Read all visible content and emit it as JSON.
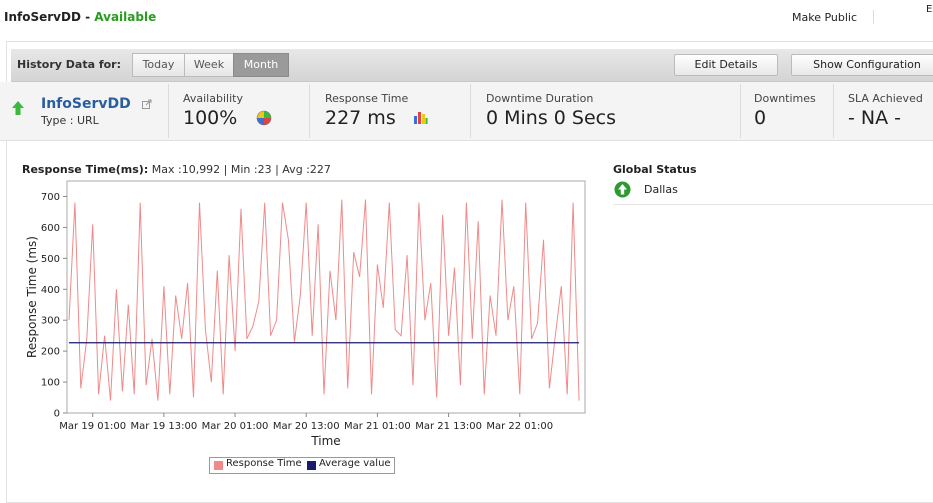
{
  "header": {
    "monitor_name": "InfoServDD",
    "separator": "-",
    "status": "Available",
    "make_public": "Make Public",
    "corner_letter": "E"
  },
  "toolbar": {
    "history_label": "History Data for:",
    "tabs": [
      {
        "label": "Today",
        "active": false
      },
      {
        "label": "Week",
        "active": false
      },
      {
        "label": "Month",
        "active": true
      }
    ],
    "edit_details": "Edit Details",
    "show_configuration": "Show Configuration"
  },
  "summary": {
    "name": "InfoServDD",
    "type": "Type : URL",
    "availability_label": "Availability",
    "availability_value": "100%",
    "response_label": "Response Time",
    "response_value": "227 ms",
    "downtime_duration_label": "Downtime Duration",
    "downtime_duration_value": "0 Mins 0 Secs",
    "downtimes_label": "Downtimes",
    "downtimes_value": "0",
    "sla_label": "SLA Achieved",
    "sla_value": "- NA -"
  },
  "chart_header": {
    "title": "Response Time(ms):",
    "stats": "Max :10,992 | Min :23 | Avg :227"
  },
  "global_status": {
    "title": "Global Status",
    "locations": [
      {
        "name": "Dallas",
        "status": "up"
      }
    ]
  },
  "colors": {
    "available": "#2a9d1f",
    "link": "#2a5d9f",
    "response_series": "#f08a8a",
    "average_series": "#1a1a6e"
  },
  "chart_data": {
    "type": "line",
    "title": "",
    "xlabel": "Time",
    "ylabel": "Response Time (ms)",
    "ylim": [
      0,
      750
    ],
    "yticks": [
      0,
      100,
      200,
      300,
      400,
      500,
      600,
      700
    ],
    "xlim": [
      "Mar 18 20:40",
      "Mar 22 12:00"
    ],
    "x_tick_labels": [
      "Mar 19 01:00",
      "Mar 19 13:00",
      "Mar 20 01:00",
      "Mar 20 13:00",
      "Mar 21 01:00",
      "Mar 21 13:00",
      "Mar 22 01:00"
    ],
    "grid": false,
    "legend": "bottom",
    "series": [
      {
        "name": "Response Time",
        "color": "#f08a8a",
        "x": [
          "Mar 18 21:00",
          "Mar 18 22:00",
          "Mar 18 23:00",
          "Mar 19 00:00",
          "Mar 19 01:00",
          "Mar 19 02:00",
          "Mar 19 03:00",
          "Mar 19 04:00",
          "Mar 19 05:00",
          "Mar 19 06:00",
          "Mar 19 07:00",
          "Mar 19 08:00",
          "Mar 19 09:00",
          "Mar 19 10:00",
          "Mar 19 11:00",
          "Mar 19 12:00",
          "Mar 19 13:00",
          "Mar 19 14:00",
          "Mar 19 15:00",
          "Mar 19 16:00",
          "Mar 19 17:00",
          "Mar 19 18:00",
          "Mar 19 19:00",
          "Mar 19 20:00",
          "Mar 19 21:00",
          "Mar 19 22:00",
          "Mar 19 23:00",
          "Mar 20 00:00",
          "Mar 20 01:00",
          "Mar 20 02:00",
          "Mar 20 03:00",
          "Mar 20 04:00",
          "Mar 20 05:00",
          "Mar 20 06:00",
          "Mar 20 07:00",
          "Mar 20 08:00",
          "Mar 20 09:00",
          "Mar 20 10:00",
          "Mar 20 11:00",
          "Mar 20 12:00",
          "Mar 20 13:00",
          "Mar 20 14:00",
          "Mar 20 15:00",
          "Mar 20 16:00",
          "Mar 20 17:00",
          "Mar 20 18:00",
          "Mar 20 19:00",
          "Mar 20 20:00",
          "Mar 20 21:00",
          "Mar 20 22:00",
          "Mar 20 23:00",
          "Mar 21 00:00",
          "Mar 21 01:00",
          "Mar 21 02:00",
          "Mar 21 03:00",
          "Mar 21 04:00",
          "Mar 21 05:00",
          "Mar 21 06:00",
          "Mar 21 07:00",
          "Mar 21 08:00",
          "Mar 21 09:00",
          "Mar 21 10:00",
          "Mar 21 11:00",
          "Mar 21 12:00",
          "Mar 21 13:00",
          "Mar 21 14:00",
          "Mar 21 15:00",
          "Mar 21 16:00",
          "Mar 21 17:00",
          "Mar 21 18:00",
          "Mar 21 19:00",
          "Mar 21 20:00",
          "Mar 21 21:00",
          "Mar 21 22:00",
          "Mar 21 23:00",
          "Mar 22 00:00",
          "Mar 22 01:00",
          "Mar 22 02:00",
          "Mar 22 03:00",
          "Mar 22 04:00",
          "Mar 22 05:00",
          "Mar 22 06:00",
          "Mar 22 07:00",
          "Mar 22 08:00",
          "Mar 22 09:00",
          "Mar 22 10:00",
          "Mar 22 11:00"
        ],
        "values": [
          300,
          680,
          80,
          240,
          610,
          60,
          250,
          40,
          400,
          70,
          350,
          60,
          680,
          90,
          240,
          40,
          410,
          60,
          380,
          240,
          420,
          50,
          680,
          270,
          100,
          460,
          60,
          510,
          200,
          660,
          240,
          280,
          360,
          680,
          250,
          300,
          680,
          560,
          230,
          380,
          680,
          250,
          610,
          60,
          460,
          300,
          690,
          80,
          520,
          440,
          690,
          60,
          480,
          340,
          680,
          270,
          250,
          510,
          90,
          680,
          300,
          420,
          50,
          640,
          250,
          470,
          90,
          680,
          240,
          620,
          60,
          380,
          250,
          690,
          300,
          410,
          60,
          680,
          240,
          290,
          560,
          80,
          250,
          410,
          60,
          680,
          40
        ]
      },
      {
        "name": "Average value",
        "color": "#1a1a6e",
        "x": [
          "Mar 18 21:00",
          "Mar 22 11:00"
        ],
        "values": [
          227,
          227
        ]
      }
    ]
  }
}
